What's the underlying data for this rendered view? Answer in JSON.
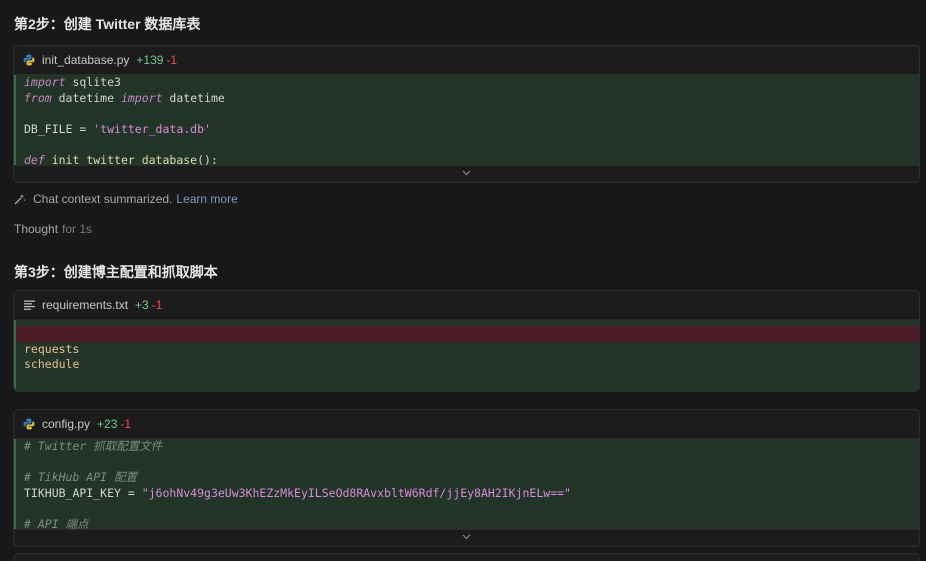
{
  "step2": {
    "heading": "第2步：创建 Twitter 数据库表",
    "file": {
      "name": "init_database.py",
      "added": "+139",
      "removed": "-1",
      "icon": "python-file-icon"
    },
    "code": {
      "line1_kw": "import",
      "line1_rest": " sqlite3",
      "line2_kw1": "from",
      "line2_mid": " datetime ",
      "line2_kw2": "import",
      "line2_rest": " datetime",
      "line4_name": "DB_FILE = ",
      "line4_str": "'twitter_data.db'",
      "line6_kw": "def",
      "line6_fn": " init_twitter_database",
      "line6_rest": "():"
    }
  },
  "chat_context": {
    "text": "Chat context summarized.",
    "link": "Learn more"
  },
  "thought": {
    "label": "Thought",
    "duration": "for 1s"
  },
  "step3": {
    "heading": "第3步：创建博主配置和抓取脚本",
    "requirements": {
      "name": "requirements.txt",
      "added": "+3",
      "removed": "-1",
      "icon": "text-file-icon",
      "lines": [
        "requests",
        "schedule"
      ]
    },
    "config": {
      "name": "config.py",
      "added": "+23",
      "removed": "-1",
      "icon": "python-file-icon",
      "comment1": "# Twitter 抓取配置文件",
      "comment2": "# TikHub API 配置",
      "key_name": "TIKHUB_API_KEY = ",
      "key_value": "\"j6ohNv49g3eUw3KhEZzMkEyILSeOd8RAvxbltW6Rdf/jjEy8AH2IKjnELw==\"",
      "comment3": "# API 端点"
    }
  }
}
